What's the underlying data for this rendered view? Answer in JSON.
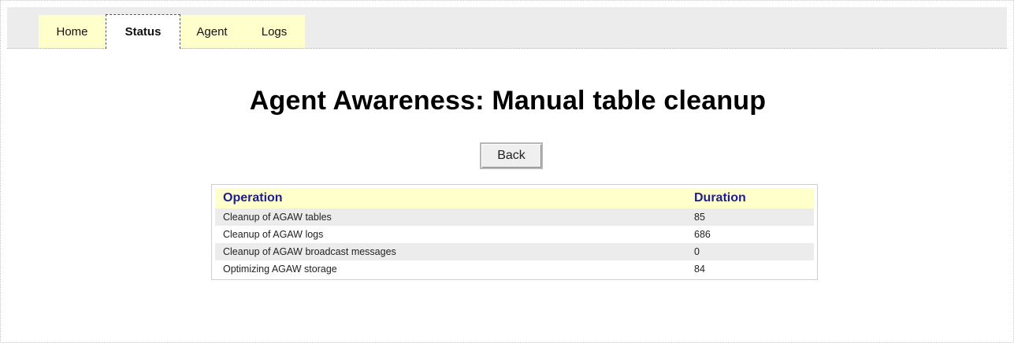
{
  "tabs": [
    {
      "label": "Home"
    },
    {
      "label": "Status"
    },
    {
      "label": "Agent"
    },
    {
      "label": "Logs"
    }
  ],
  "active_tab": "Status",
  "page": {
    "title": "Agent Awareness: Manual table cleanup",
    "back_label": "Back"
  },
  "table": {
    "columns": [
      "Operation",
      "Duration"
    ],
    "rows": [
      {
        "operation": "Cleanup of AGAW tables",
        "duration": "85"
      },
      {
        "operation": "Cleanup of AGAW logs",
        "duration": "686"
      },
      {
        "operation": "Cleanup of AGAW broadcast messages",
        "duration": "0"
      },
      {
        "operation": "Optimizing AGAW storage",
        "duration": "84"
      }
    ]
  },
  "colors": {
    "tab_bg": "#ffffcc",
    "header_bg": "#ffffcc",
    "header_text": "#1d1d8f",
    "row_alt": "#ececec"
  }
}
